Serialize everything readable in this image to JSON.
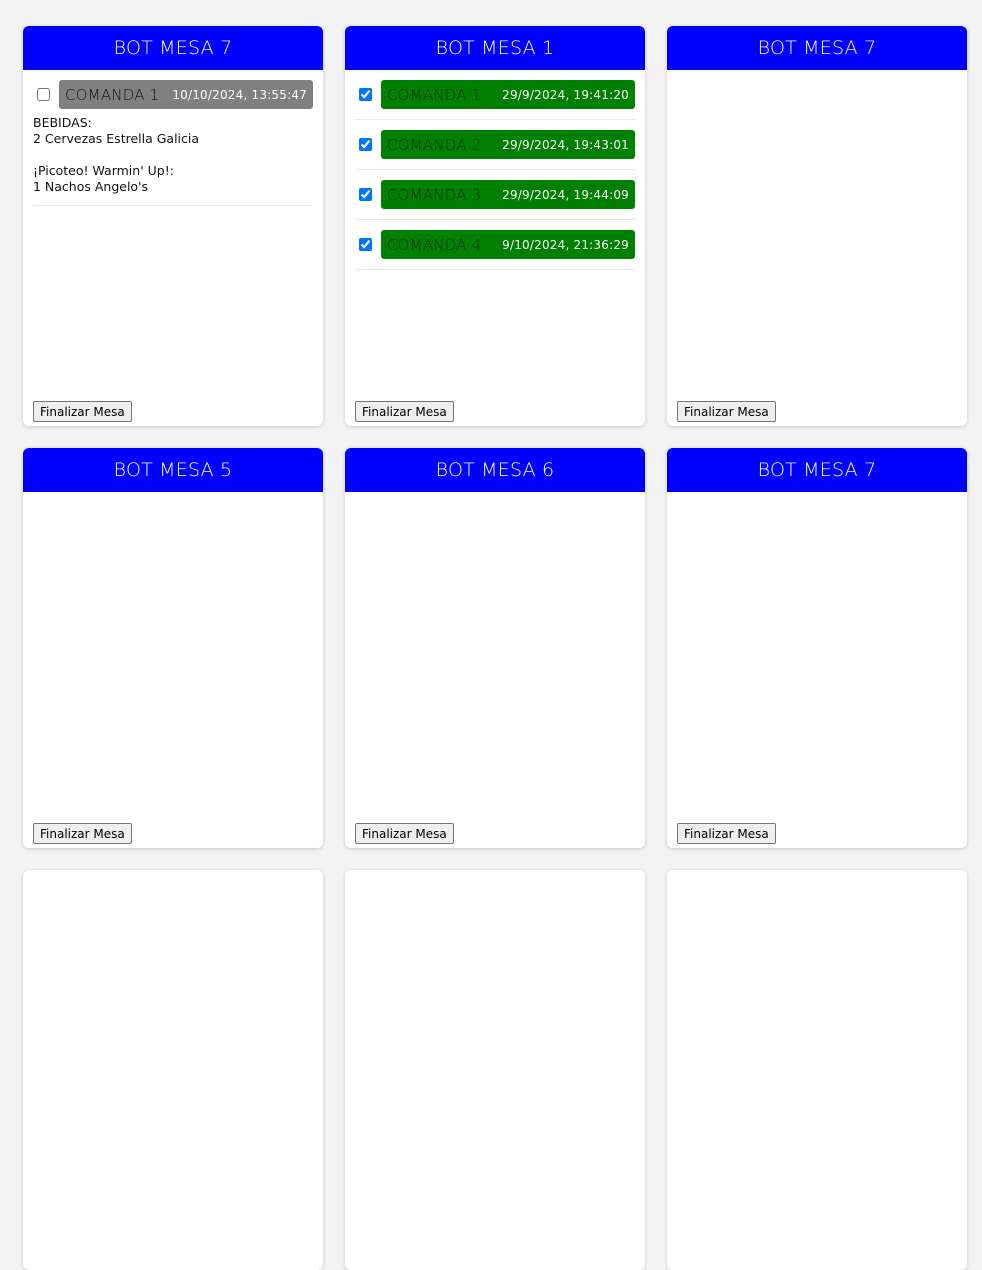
{
  "colors": {
    "header_bg": "#0000ff",
    "pending_order": "#808080",
    "done_order": "#008000",
    "page_bg": "#f3f3f3"
  },
  "tables": [
    {
      "title": "BOT MESA 7",
      "finalize_label": "Finalizar Mesa",
      "orders": [
        {
          "label": "COMANDA 1",
          "time": "10/10/2024, 13:55:47",
          "checked": false,
          "items": "BEBIDAS:\n2 Cervezas Estrella Galicia\n\n¡Picoteo! Warmin' Up!:\n1 Nachos Angelo's"
        }
      ]
    },
    {
      "title": "BOT MESA 1",
      "finalize_label": "Finalizar Mesa",
      "orders": [
        {
          "label": "COMANDA 1",
          "time": "29/9/2024, 19:41:20",
          "checked": true
        },
        {
          "label": "COMANDA 2",
          "time": "29/9/2024, 19:43:01",
          "checked": true
        },
        {
          "label": "COMANDA 3",
          "time": "29/9/2024, 19:44:09",
          "checked": true
        },
        {
          "label": "COMANDA 4",
          "time": "9/10/2024, 21:36:29",
          "checked": true
        }
      ]
    },
    {
      "title": "BOT MESA 7",
      "finalize_label": "Finalizar Mesa",
      "orders": []
    },
    {
      "title": "BOT MESA 5",
      "finalize_label": "Finalizar Mesa",
      "orders": []
    },
    {
      "title": "BOT MESA 6",
      "finalize_label": "Finalizar Mesa",
      "orders": []
    },
    {
      "title": "BOT MESA 7",
      "finalize_label": "Finalizar Mesa",
      "orders": []
    }
  ]
}
